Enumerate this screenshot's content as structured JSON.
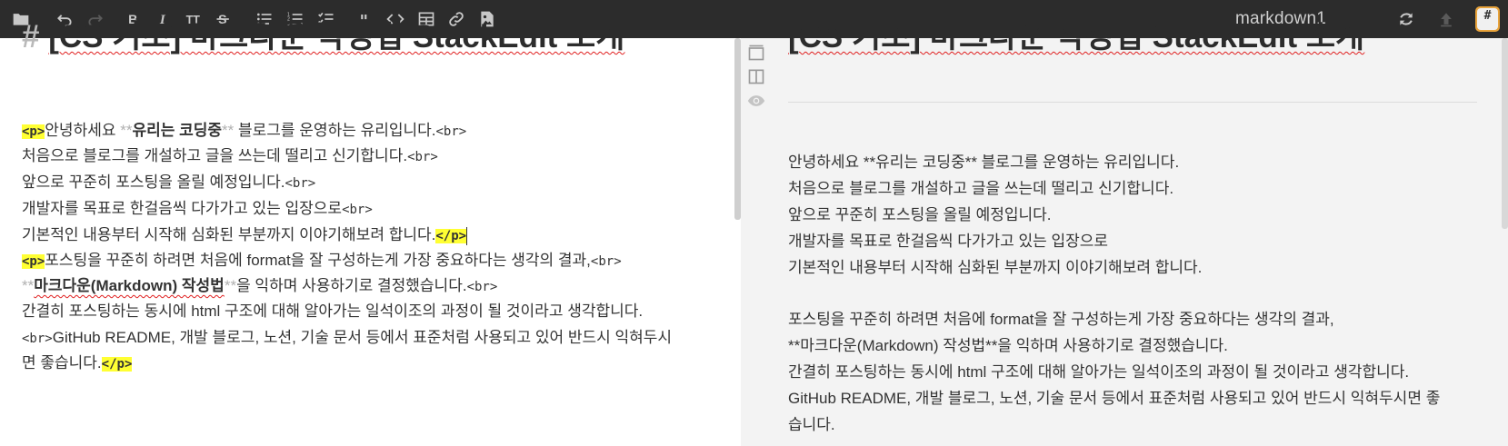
{
  "toolbar": {
    "doc_title": "markdown1",
    "hash_button_label": "#",
    "icons": [
      "folder-icon",
      "undo-icon",
      "redo-icon",
      "bold-icon",
      "italic-icon",
      "heading-icon",
      "strikethrough-icon",
      "unordered-list-icon",
      "ordered-list-icon",
      "checklist-icon",
      "quote-icon",
      "code-icon",
      "table-icon",
      "link-icon",
      "image-icon",
      "sync-icon",
      "publish-icon"
    ]
  },
  "editor": {
    "heading_hash": "#",
    "heading_text": "[CS 기초] 마크다운 작성법 StackEdit 소개",
    "lines": [
      {
        "t1": "<p>",
        "t2": "안녕하세요 ",
        "t3": "**",
        "t4": "유리는 코딩중",
        "t5": "**",
        "t6": " 블로그를 운영하는 유리입니다.",
        "t7": "<br>"
      },
      {
        "t1": "처음으로 블로그를 개설하고 글을 쓰는데 떨리고 신기합니다.",
        "t2": "<br>"
      },
      {
        "t1": "앞으로 꾸준히 포스팅을 올릴 예정입니다.",
        "t2": "<br>"
      },
      {
        "t1": "개발자를 목표로 한걸음씩 다가가고 있는 입장으로",
        "t2": "<br>"
      },
      {
        "t1": "기본적인 내용부터 시작해 심화된 부분까지 이야기해보려 합니다.",
        "t2": "</p>"
      },
      {
        "t1": "<p>",
        "t2": "포스팅을 꾸준히 하려면 처음에 format을 잘 구성하는게 가장 중요하다는 생각의 결과,",
        "t3": "<br>"
      },
      {
        "t1": "**",
        "t2": "마크다운(Markdown) 작성법",
        "t3": "**",
        "t4": "을 익하며 사용하기로 결정했습니다.",
        "t5": "<br>"
      },
      {
        "t1": "간결히 포스팅하는 동시에 html 구조에 대해 알아가는 일석이조의  과정이 될 것이라고 생각합니다."
      },
      {
        "t1": "<br>",
        "t2": "GitHub README, 개발 블로그, 노션, 기술 문서 등에서 표준처럼 사용되고 있어 반드시 익혀두시"
      },
      {
        "t1": "면 좋습니다.",
        "t2": "</p>"
      }
    ]
  },
  "sidebar": {
    "icons": [
      "preview-only-icon",
      "side-by-side-icon",
      "eye-icon"
    ]
  },
  "preview": {
    "heading": "[CS 기초] 마크다운 작성법 StackEdit 소개",
    "paragraph1": [
      "안녕하세요 **유리는 코딩중** 블로그를 운영하는 유리입니다.",
      "처음으로 블로그를 개설하고 글을 쓰는데 떨리고 신기합니다.",
      "앞으로 꾸준히 포스팅을 올릴 예정입니다.",
      "개발자를 목표로 한걸음씩 다가가고 있는 입장으로",
      "기본적인 내용부터 시작해 심화된 부분까지 이야기해보려 합니다."
    ],
    "paragraph2": [
      "포스팅을 꾸준히 하려면 처음에 format을 잘 구성하는게 가장 중요하다는 생각의 결과,",
      "**마크다운(Markdown) 작성법**을 익하며 사용하기로 결정했습니다.",
      "간결히 포스팅하는 동시에 html 구조에 대해 알아가는 일석이조의 과정이 될 것이라고 생각합니다.",
      "GitHub README, 개발 블로그, 노션, 기술 문서 등에서 표준처럼 사용되고 있어 반드시 익혀두시면 좋",
      "습니다."
    ]
  },
  "colors": {
    "toolbar_bg": "#2c2c2c",
    "highlight": "#ffff33",
    "preview_bg": "#f3f3f3",
    "accent": "#e8a33b"
  }
}
